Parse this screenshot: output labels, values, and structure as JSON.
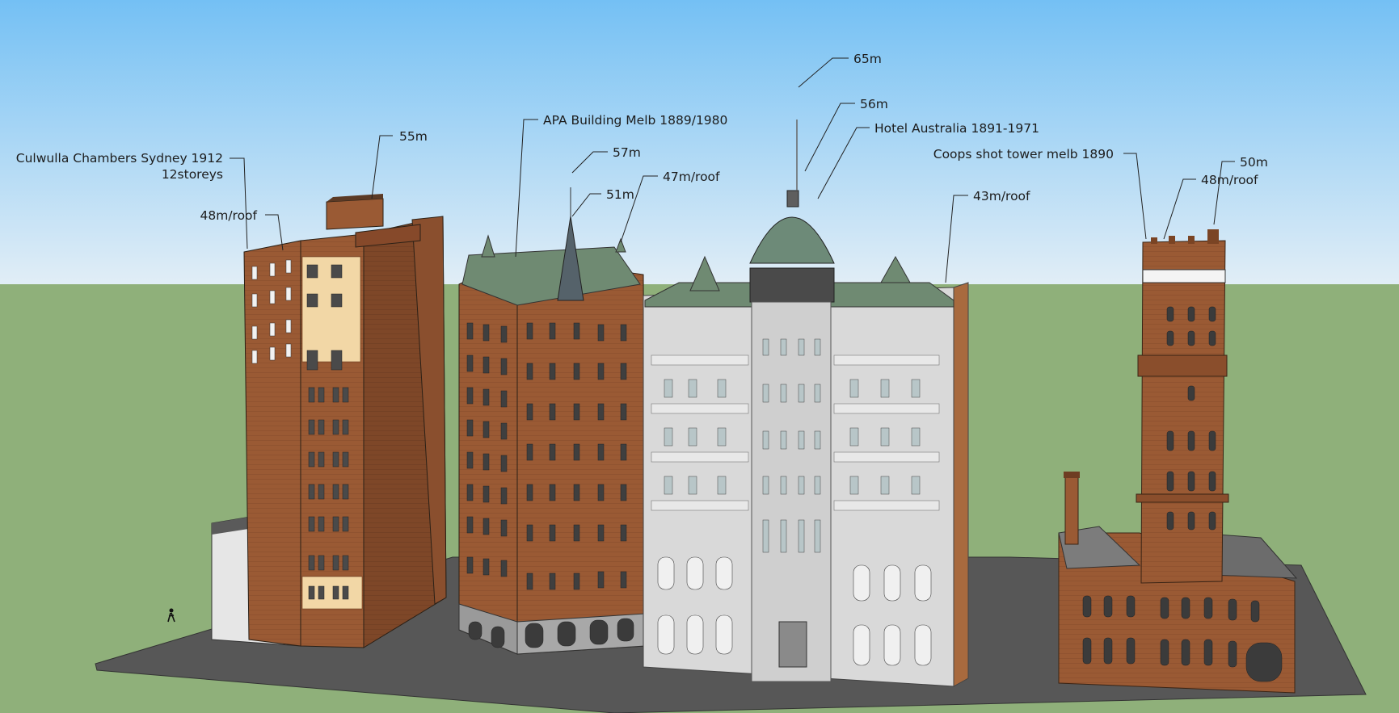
{
  "colors": {
    "sky_top": "#7cc3f4",
    "sky_bottom": "#dcecf6",
    "grass": "#8fb07a",
    "ground": "#575757",
    "brick": "#9a5a34",
    "brick_dark": "#7d4526",
    "stone": "#d6d6d6",
    "roof_green": "#6f8a72"
  },
  "annotations": {
    "culwulla_title": "Culwulla Chambers Sydney 1912",
    "culwulla_storeys": "12storeys",
    "culwulla_roof": "48m/roof",
    "culwulla_top": "55m",
    "apa_title": "APA Building Melb 1889/1980",
    "apa_spire": "57m",
    "apa_51": "51m",
    "apa_roof": "47m/roof",
    "hotel_mast": "65m",
    "hotel_dome": "56m",
    "hotel_title": "Hotel Australia 1891-1971",
    "hotel_roof": "43m/roof",
    "coops_title": "Coops shot tower melb 1890",
    "coops_top": "50m",
    "coops_roof": "48m/roof"
  },
  "icons": [
    "person-figure-icon"
  ]
}
